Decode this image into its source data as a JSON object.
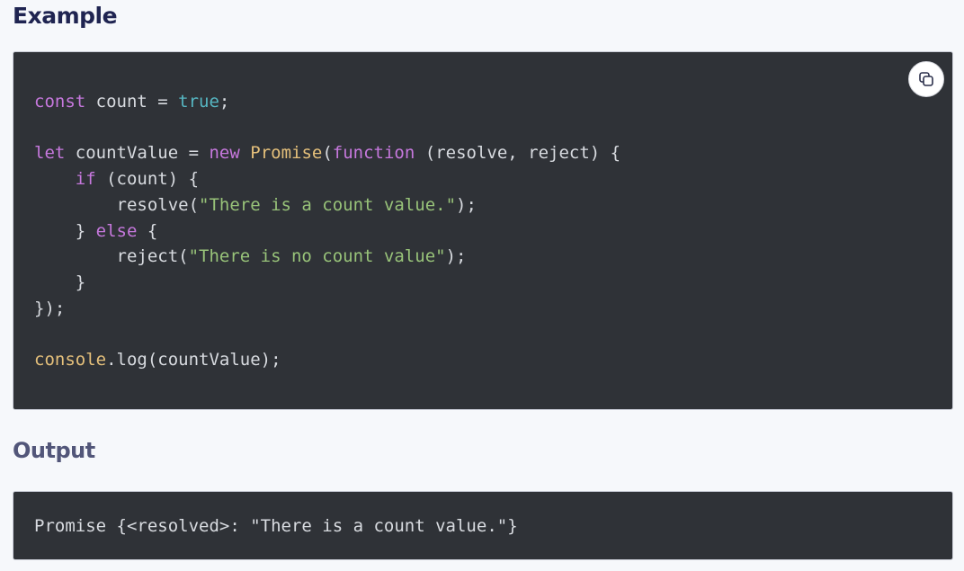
{
  "example": {
    "heading": "Example",
    "copy_icon": "copy-icon",
    "code": [
      [
        {
          "t": "const",
          "c": "kw"
        },
        {
          "t": " count = ",
          "c": "plain"
        },
        {
          "t": "true",
          "c": "bool"
        },
        {
          "t": ";",
          "c": "plain"
        }
      ],
      [],
      [
        {
          "t": "let",
          "c": "kw"
        },
        {
          "t": " countValue = ",
          "c": "plain"
        },
        {
          "t": "new",
          "c": "kw"
        },
        {
          "t": " ",
          "c": "plain"
        },
        {
          "t": "Promise",
          "c": "cls"
        },
        {
          "t": "(",
          "c": "plain"
        },
        {
          "t": "function",
          "c": "kw"
        },
        {
          "t": " (resolve, reject) {",
          "c": "plain"
        }
      ],
      [
        {
          "t": "    ",
          "c": "plain"
        },
        {
          "t": "if",
          "c": "kw"
        },
        {
          "t": " (count) {",
          "c": "plain"
        }
      ],
      [
        {
          "t": "        resolve(",
          "c": "plain"
        },
        {
          "t": "\"There is a count value.\"",
          "c": "str"
        },
        {
          "t": ");",
          "c": "plain"
        }
      ],
      [
        {
          "t": "    } ",
          "c": "plain"
        },
        {
          "t": "else",
          "c": "kw"
        },
        {
          "t": " {",
          "c": "plain"
        }
      ],
      [
        {
          "t": "        reject(",
          "c": "plain"
        },
        {
          "t": "\"There is no count value\"",
          "c": "str"
        },
        {
          "t": ");",
          "c": "plain"
        }
      ],
      [
        {
          "t": "    }",
          "c": "plain"
        }
      ],
      [
        {
          "t": "});",
          "c": "plain"
        }
      ],
      [],
      [
        {
          "t": "console",
          "c": "cls"
        },
        {
          "t": ".log(countValue);",
          "c": "plain"
        }
      ]
    ]
  },
  "output": {
    "heading": "Output",
    "text": "Promise {<resolved>: \"There is a count value.\"}"
  }
}
